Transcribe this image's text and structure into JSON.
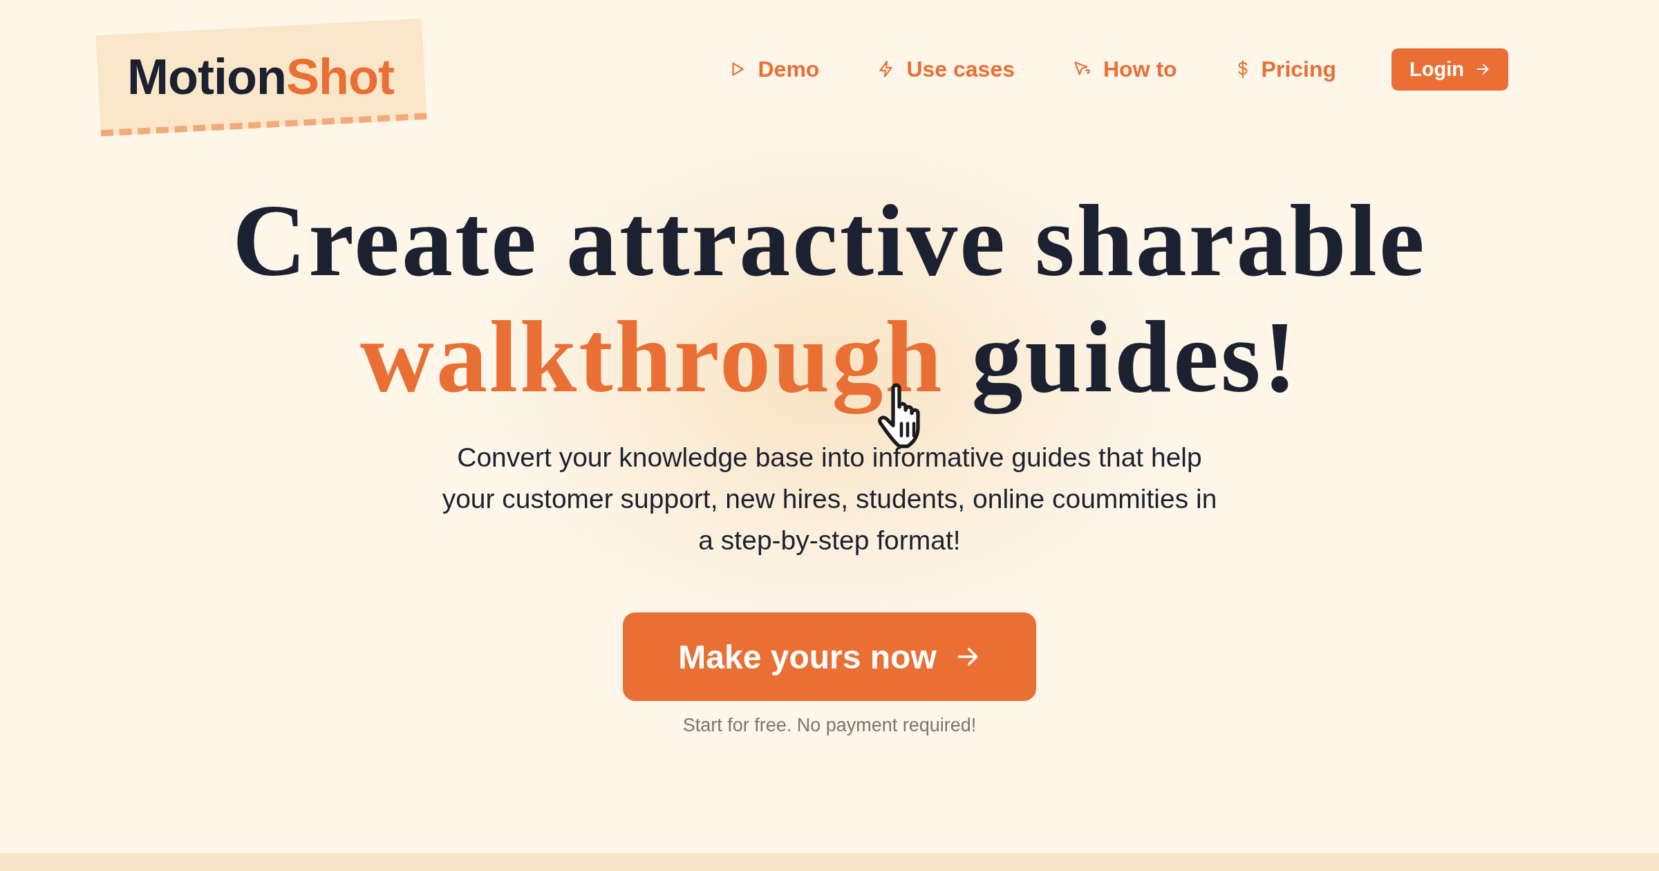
{
  "logo": {
    "first": "Motion",
    "second": "Shot"
  },
  "nav": [
    {
      "kind": "play",
      "label": "Demo"
    },
    {
      "kind": "bolt",
      "label": "Use cases"
    },
    {
      "kind": "cursor",
      "label": "How to"
    },
    {
      "kind": "dollar",
      "label": "Pricing"
    }
  ],
  "login_button": {
    "label": "Login"
  },
  "headline": {
    "line_1": "Create attractive sharable",
    "highlight": "walkthrough",
    "rest": "guides!"
  },
  "description": "Convert your knowledge base into informative guides that help your customer support, new hires, students, online coummities in a step-by-step format!",
  "cta_button": {
    "label": "Make yours now"
  },
  "cta_note": "Start for free. No payment required!"
}
